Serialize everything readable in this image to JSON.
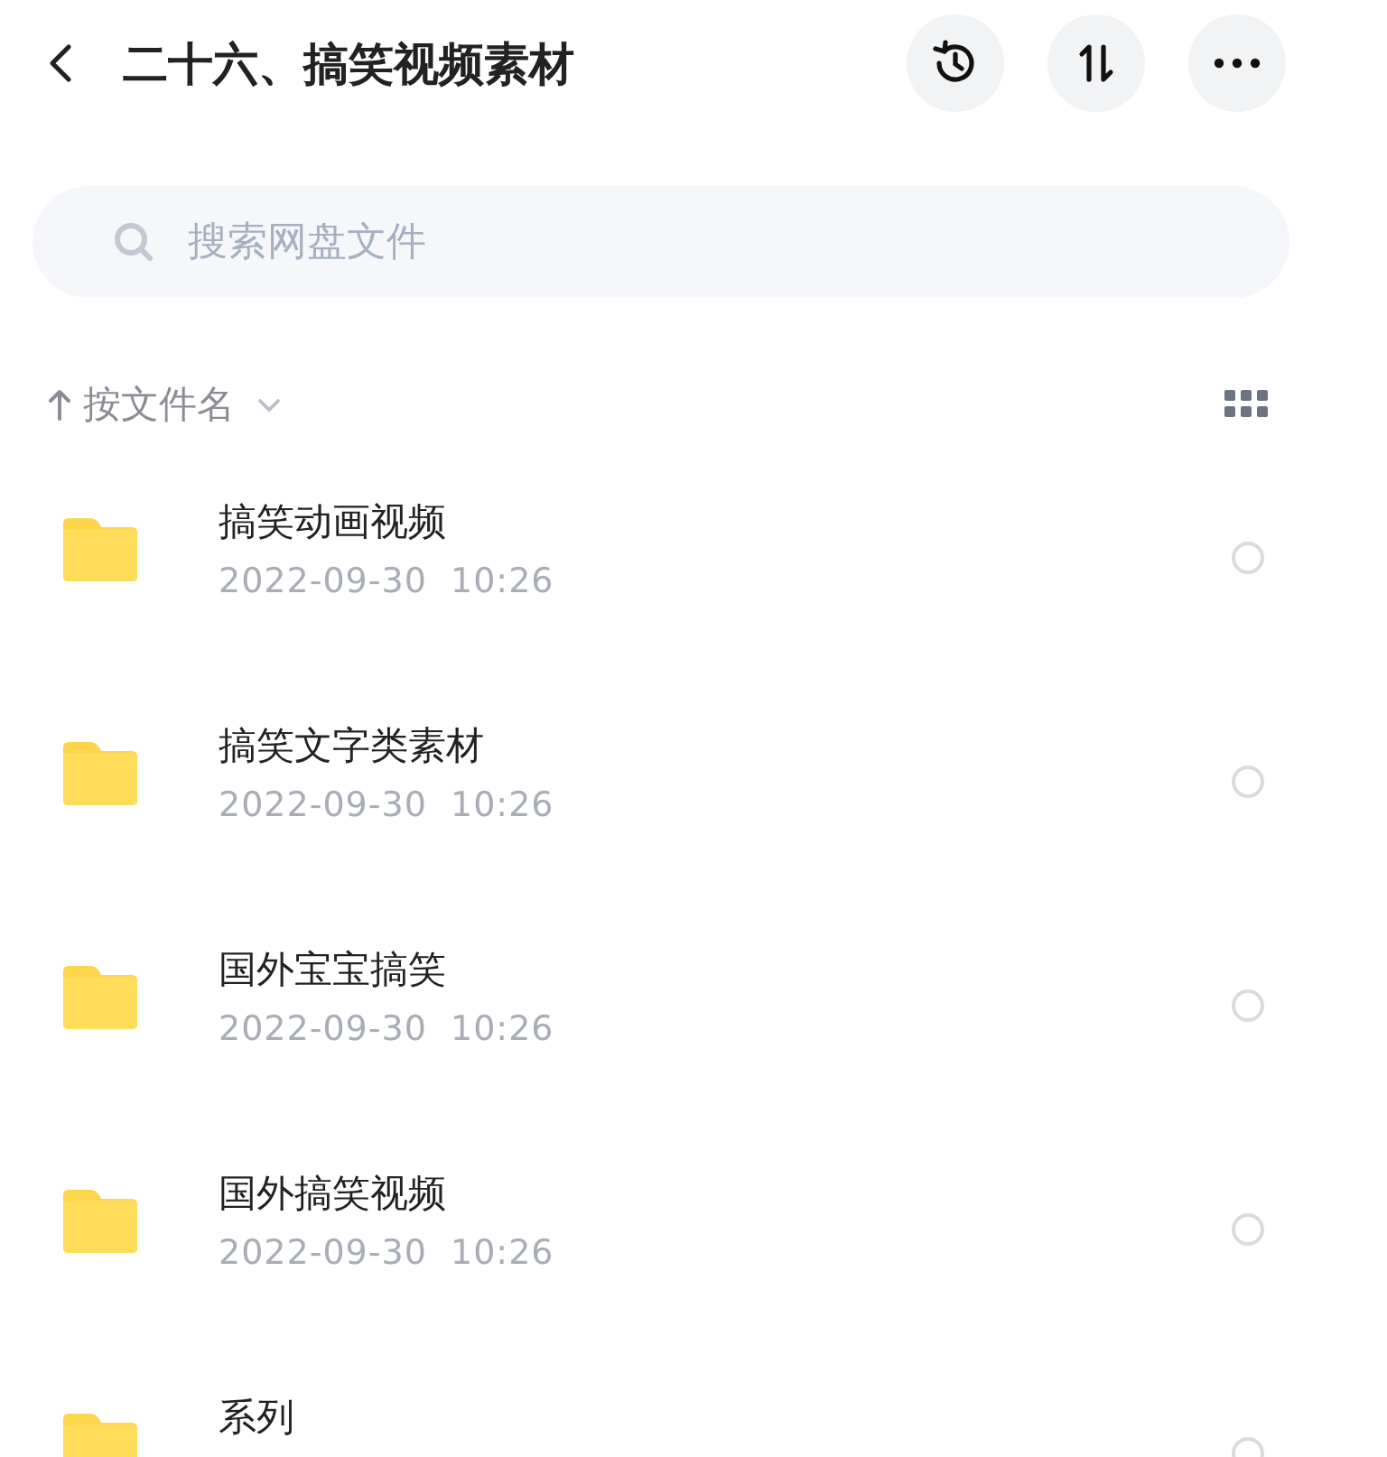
{
  "header": {
    "title": "二十六、搞笑视频素材"
  },
  "search": {
    "placeholder": "搜索网盘文件"
  },
  "sort": {
    "label": "按文件名"
  },
  "files": [
    {
      "name": "搞笑动画视频",
      "date": "2022-09-30  10:26",
      "selected": false
    },
    {
      "name": "搞笑文字类素材",
      "date": "2022-09-30  10:26",
      "selected": false
    },
    {
      "name": "国外宝宝搞笑",
      "date": "2022-09-30  10:26",
      "selected": false
    },
    {
      "name": "国外搞笑视频",
      "date": "2022-09-30  10:26",
      "selected": false
    },
    {
      "name": "系列",
      "selected": false
    }
  ]
}
